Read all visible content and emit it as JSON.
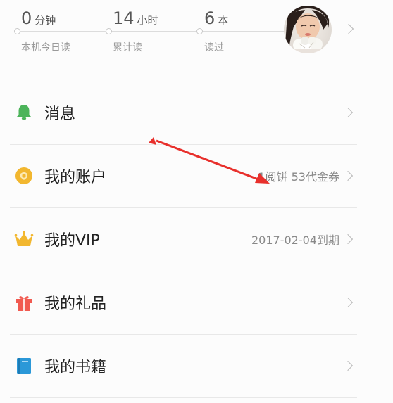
{
  "stats": [
    {
      "value": "0",
      "unit": "分钟",
      "label": "本机今日读"
    },
    {
      "value": "14",
      "unit": "小时",
      "label": "累计读"
    },
    {
      "value": "6",
      "unit": "本",
      "label": "读过"
    }
  ],
  "menu": [
    {
      "title": "消息",
      "value": "",
      "icon": "bell-icon"
    },
    {
      "title": "我的账户",
      "value": "1阅饼  53代金券",
      "icon": "coin-icon"
    },
    {
      "title": "我的VIP",
      "value": "2017-02-04到期",
      "icon": "crown-icon"
    },
    {
      "title": "我的礼品",
      "value": "",
      "icon": "gift-icon"
    },
    {
      "title": "我的书籍",
      "value": "",
      "icon": "book-icon"
    }
  ],
  "colors": {
    "bell": "#4cb45a",
    "coin": "#f2b72f",
    "crown": "#f2b72f",
    "gift": "#f15a50",
    "book": "#2b98d8",
    "annotation_arrow": "#e8302c"
  }
}
